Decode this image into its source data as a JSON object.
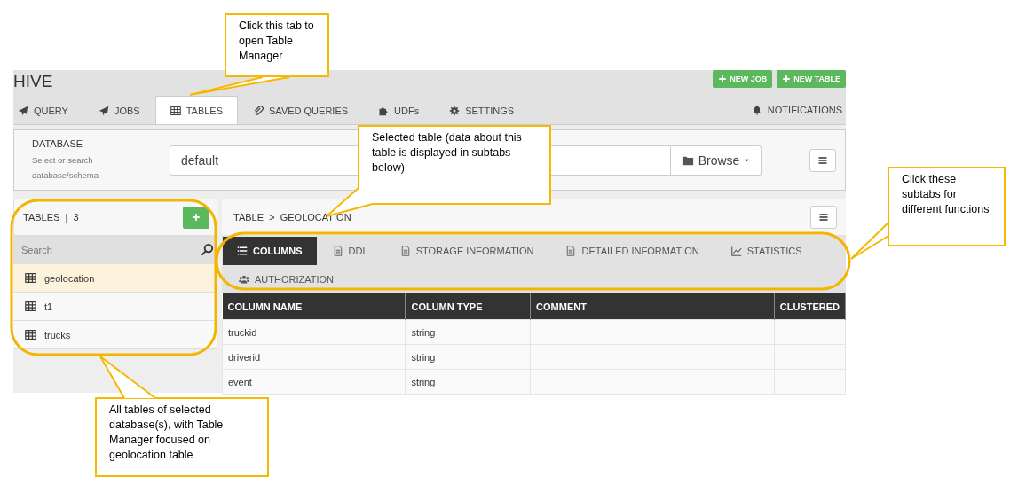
{
  "app": {
    "title": "HIVE",
    "actions": [
      {
        "label": "NEW JOB"
      },
      {
        "label": "NEW TABLE"
      }
    ],
    "nav_tabs": [
      {
        "label": "QUERY",
        "selected": false
      },
      {
        "label": "JOBS",
        "selected": false
      },
      {
        "label": "TABLES",
        "selected": true
      },
      {
        "label": "SAVED QUERIES",
        "selected": false
      },
      {
        "label": "UDFs",
        "selected": false
      },
      {
        "label": "SETTINGS",
        "selected": false
      }
    ],
    "notifications": "NOTIFICATIONS",
    "database": {
      "label": "DATABASE",
      "hint": "Select or search database/schema",
      "value": "default",
      "browse": "Browse"
    },
    "tables_panel": {
      "title": "TABLES",
      "separator": "|",
      "count": "3",
      "search_placeholder": "Search",
      "items": [
        {
          "name": "geolocation",
          "selected": true
        },
        {
          "name": "t1",
          "selected": false
        },
        {
          "name": "trucks",
          "selected": false
        }
      ]
    },
    "breadcrumb": {
      "root": "TABLE",
      "separator": ">",
      "current": "GEOLOCATION"
    },
    "subtabs": [
      {
        "label": "COLUMNS",
        "selected": true
      },
      {
        "label": "DDL",
        "selected": false
      },
      {
        "label": "STORAGE INFORMATION",
        "selected": false
      },
      {
        "label": "DETAILED INFORMATION",
        "selected": false
      },
      {
        "label": "STATISTICS",
        "selected": false
      },
      {
        "label": "AUTHORIZATION",
        "selected": false
      }
    ],
    "table": {
      "columns": [
        "COLUMN NAME",
        "COLUMN TYPE",
        "COMMENT",
        "CLUSTERED"
      ],
      "rows": [
        [
          "truckid",
          "string",
          "",
          ""
        ],
        [
          "driverid",
          "string",
          "",
          ""
        ],
        [
          "event",
          "string",
          "",
          ""
        ]
      ]
    }
  },
  "callouts": [
    "Click this tab to open Table Manager",
    "Selected table (data about this table is displayed in subtabs below)",
    "Click these subtabs for different functions",
    "All tables of selected database(s), with Table Manager focused on geolocation table"
  ]
}
